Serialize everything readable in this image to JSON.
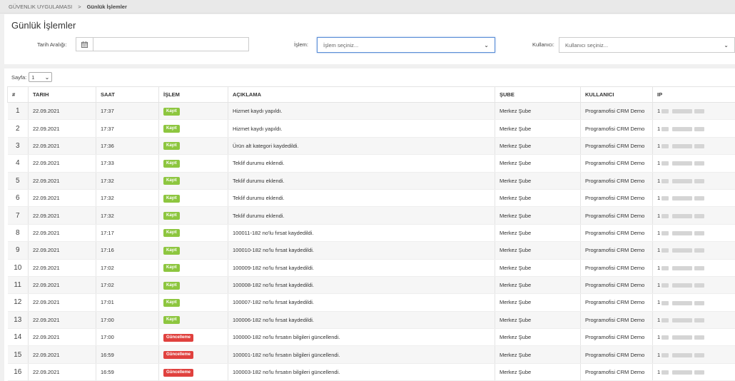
{
  "breadcrumb": {
    "root": "GÜVENLIK UYGULAMASI",
    "separator": ">",
    "current": "Günlük İşlemler"
  },
  "page_title": "Günlük İşlemler",
  "filters": {
    "date_label": "Tarih Aralığı:",
    "date_value": "",
    "operation_label": "İşlem:",
    "operation_placeholder": "İşlem seçiniz...",
    "user_label": "Kullanıcı:",
    "user_placeholder": "Kullanıcı seçiniz..."
  },
  "pager": {
    "label": "Sayfa:",
    "value": "1"
  },
  "badge_colors": {
    "Kayıt": "#8dc63f",
    "Güncelleme": "#e0413e"
  },
  "table": {
    "headers": [
      "#",
      "TARIH",
      "SAAT",
      "İŞLEM",
      "AÇIKLAMA",
      "ŞUBE",
      "KULLANICI",
      "IP"
    ],
    "rows": [
      {
        "no": "1",
        "date": "22.09.2021",
        "time": "17:37",
        "op": "Kayıt",
        "desc": "Hizmet kaydı yapıldı.",
        "branch": "Merkez Şube",
        "user": "Programofisi CRM Demo",
        "ip": "1"
      },
      {
        "no": "2",
        "date": "22.09.2021",
        "time": "17:37",
        "op": "Kayıt",
        "desc": "Hizmet kaydı yapıldı.",
        "branch": "Merkez Şube",
        "user": "Programofisi CRM Demo",
        "ip": "1"
      },
      {
        "no": "3",
        "date": "22.09.2021",
        "time": "17:36",
        "op": "Kayıt",
        "desc": "Ürün alt kategori kaydedildi.",
        "branch": "Merkez Şube",
        "user": "Programofisi CRM Demo",
        "ip": "1"
      },
      {
        "no": "4",
        "date": "22.09.2021",
        "time": "17:33",
        "op": "Kayıt",
        "desc": "Teklif durumu eklendi.",
        "branch": "Merkez Şube",
        "user": "Programofisi CRM Demo",
        "ip": "1"
      },
      {
        "no": "5",
        "date": "22.09.2021",
        "time": "17:32",
        "op": "Kayıt",
        "desc": "Teklif durumu eklendi.",
        "branch": "Merkez Şube",
        "user": "Programofisi CRM Demo",
        "ip": "1"
      },
      {
        "no": "6",
        "date": "22.09.2021",
        "time": "17:32",
        "op": "Kayıt",
        "desc": "Teklif durumu eklendi.",
        "branch": "Merkez Şube",
        "user": "Programofisi CRM Demo",
        "ip": "1"
      },
      {
        "no": "7",
        "date": "22.09.2021",
        "time": "17:32",
        "op": "Kayıt",
        "desc": "Teklif durumu eklendi.",
        "branch": "Merkez Şube",
        "user": "Programofisi CRM Demo",
        "ip": "1"
      },
      {
        "no": "8",
        "date": "22.09.2021",
        "time": "17:17",
        "op": "Kayıt",
        "desc": "100011-182 no'lu fırsat kaydedildi.",
        "branch": "Merkez Şube",
        "user": "Programofisi CRM Demo",
        "ip": "1"
      },
      {
        "no": "9",
        "date": "22.09.2021",
        "time": "17:16",
        "op": "Kayıt",
        "desc": "100010-182 no'lu fırsat kaydedildi.",
        "branch": "Merkez Şube",
        "user": "Programofisi CRM Demo",
        "ip": "1"
      },
      {
        "no": "10",
        "date": "22.09.2021",
        "time": "17:02",
        "op": "Kayıt",
        "desc": "100009-182 no'lu fırsat kaydedildi.",
        "branch": "Merkez Şube",
        "user": "Programofisi CRM Demo",
        "ip": "1"
      },
      {
        "no": "11",
        "date": "22.09.2021",
        "time": "17:02",
        "op": "Kayıt",
        "desc": "100008-182 no'lu fırsat kaydedildi.",
        "branch": "Merkez Şube",
        "user": "Programofisi CRM Demo",
        "ip": "1"
      },
      {
        "no": "12",
        "date": "22.09.2021",
        "time": "17:01",
        "op": "Kayıt",
        "desc": "100007-182 no'lu fırsat kaydedildi.",
        "branch": "Merkez Şube",
        "user": "Programofisi CRM Demo",
        "ip": "1"
      },
      {
        "no": "13",
        "date": "22.09.2021",
        "time": "17:00",
        "op": "Kayıt",
        "desc": "100006-182 no'lu fırsat kaydedildi.",
        "branch": "Merkez Şube",
        "user": "Programofisi CRM Demo",
        "ip": "1"
      },
      {
        "no": "14",
        "date": "22.09.2021",
        "time": "17:00",
        "op": "Güncelleme",
        "desc": "100000-182 no'lu fırsatın bilgileri güncellendi.",
        "branch": "Merkez Şube",
        "user": "Programofisi CRM Demo",
        "ip": "1"
      },
      {
        "no": "15",
        "date": "22.09.2021",
        "time": "16:59",
        "op": "Güncelleme",
        "desc": "100001-182 no'lu fırsatın bilgileri güncellendi.",
        "branch": "Merkez Şube",
        "user": "Programofisi CRM Demo",
        "ip": "1"
      },
      {
        "no": "16",
        "date": "22.09.2021",
        "time": "16:59",
        "op": "Güncelleme",
        "desc": "100003-182 no'lu fırsatın bilgileri güncellendi.",
        "branch": "Merkez Şube",
        "user": "Programofisi CRM Demo",
        "ip": "1"
      }
    ]
  }
}
